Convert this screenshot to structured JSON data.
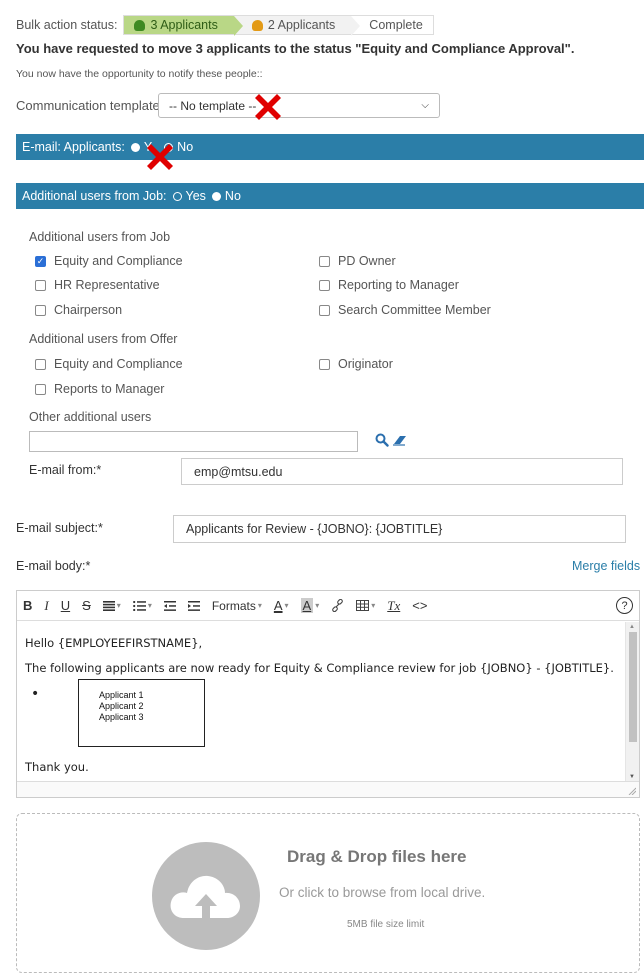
{
  "bulk": {
    "status_label": "Bulk action status:",
    "steps": [
      {
        "label": "3 Applicants",
        "state": "done",
        "icon": "green-person-icon"
      },
      {
        "label": "2 Applicants",
        "state": "warn",
        "icon": "orange-person-icon"
      },
      {
        "label": "Complete",
        "state": "pending"
      }
    ],
    "request_text": "You have requested to move 3 applicants to the status \"Equity and Compliance Approval\".",
    "notify_text": "You now have the opportunity to notify these people::"
  },
  "template": {
    "label": "Communication template:",
    "selected": "-- No template --"
  },
  "email_applicants": {
    "label": "E-mail: Applicants:",
    "yes": "Y",
    "no": "No",
    "selected": "yes"
  },
  "additional_from_job_bar": {
    "label": "Additional users from Job:",
    "yes": "Yes",
    "no": "No",
    "selected": "no"
  },
  "job_users": {
    "title": "Additional users from Job",
    "items": [
      {
        "label": "Equity and Compliance",
        "checked": true
      },
      {
        "label": "PD Owner",
        "checked": false
      },
      {
        "label": "HR Representative",
        "checked": false
      },
      {
        "label": "Reporting to Manager",
        "checked": false
      },
      {
        "label": "Chairperson",
        "checked": false
      },
      {
        "label": "Search Committee Member",
        "checked": false
      }
    ]
  },
  "offer_users": {
    "title": "Additional users from Offer",
    "items": [
      {
        "label": "Equity and Compliance",
        "checked": false
      },
      {
        "label": "Originator",
        "checked": false
      },
      {
        "label": "Reports to Manager",
        "checked": false
      }
    ]
  },
  "other_users": {
    "label": "Other additional users",
    "value": ""
  },
  "email_from": {
    "label": "E-mail from:*",
    "value": "emp@mtsu.edu"
  },
  "email_subject": {
    "label": "E-mail subject:*",
    "value": "Applicants for Review - {JOBNO}: {JOBTITLE}"
  },
  "email_body": {
    "label": "E-mail body:*",
    "merge_fields": "Merge fields",
    "toolbar": {
      "bold": "B",
      "italic": "I",
      "underline": "U",
      "strike": "S",
      "formats": "Formats",
      "font_color": "A",
      "bg_color": "A",
      "clear": "Tx",
      "code": "<>",
      "help": "?"
    },
    "greeting": "Hello {EMPLOYEEFIRSTNAME},",
    "line": "The following applicants are now ready for Equity & Compliance review for job {JOBNO} - {JOBTITLE}.",
    "applicants": [
      "Applicant 1",
      "Applicant 2",
      "Applicant 3"
    ],
    "closing": "Thank you."
  },
  "dropzone": {
    "title": "Drag & Drop files here",
    "subtitle": "Or click to browse from local drive.",
    "limit": "5MB file size limit"
  }
}
